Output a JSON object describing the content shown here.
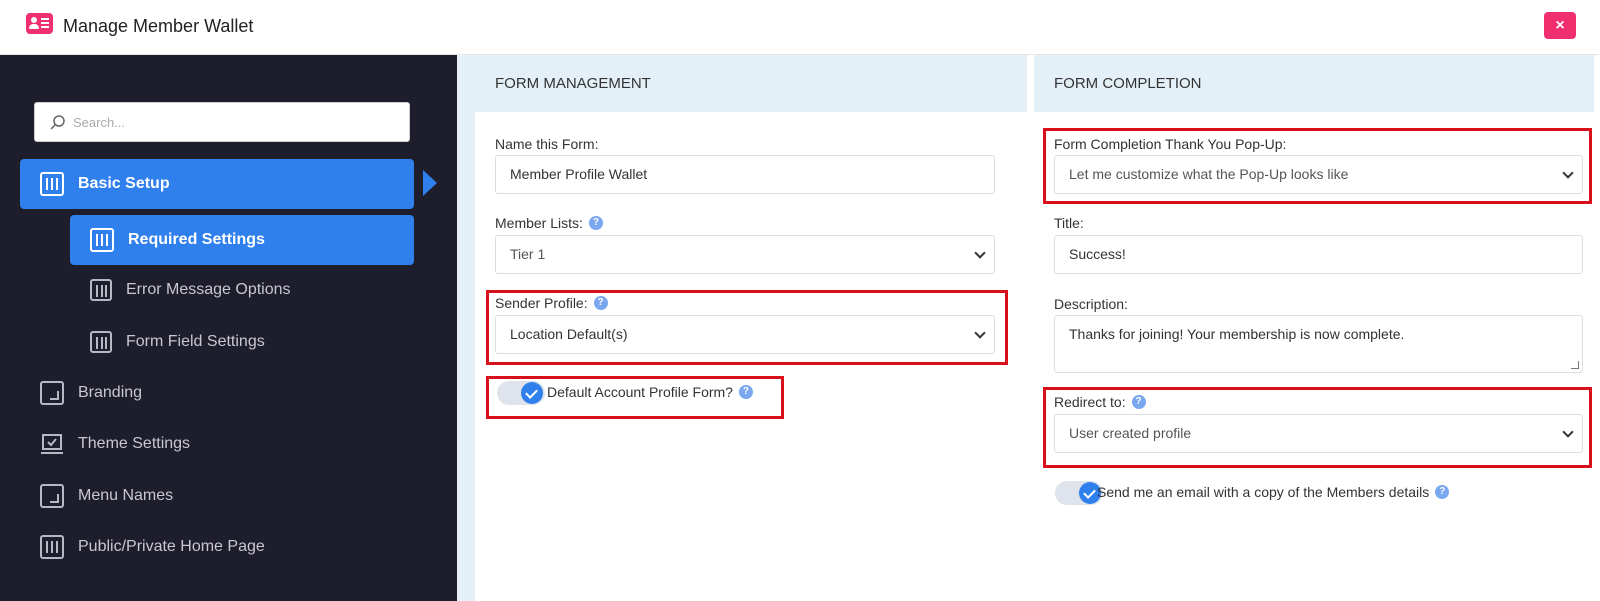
{
  "window": {
    "title": "Manage Member Wallet",
    "close_label": "×"
  },
  "sidebar": {
    "search_placeholder": "Search...",
    "items": [
      {
        "label": "Basic Setup"
      },
      {
        "label": "Required Settings"
      },
      {
        "label": "Error Message Options"
      },
      {
        "label": "Form Field Settings"
      },
      {
        "label": "Branding"
      },
      {
        "label": "Theme Settings"
      },
      {
        "label": "Menu Names"
      },
      {
        "label": "Public/Private Home Page"
      }
    ]
  },
  "form_management": {
    "heading": "FORM MANAGEMENT",
    "name_label": "Name this Form:",
    "name_value": "Member Profile Wallet",
    "lists_label": "Member Lists:",
    "lists_value": "Tier 1",
    "sender_label": "Sender Profile:",
    "sender_value": "Location Default(s)",
    "default_toggle_label": "Default Account Profile Form?"
  },
  "form_completion": {
    "heading": "FORM COMPLETION",
    "popup_label": "Form Completion Thank You Pop-Up:",
    "popup_value": "Let me customize what the Pop-Up looks like",
    "title_label": "Title:",
    "title_value": "Success!",
    "description_label": "Description:",
    "description_value": "Thanks for joining! Your membership is now complete.",
    "redirect_label": "Redirect to:",
    "redirect_value": "User created profile",
    "email_toggle_label": "Send me an email with a copy of the Members details"
  },
  "help_glyph": "?",
  "colors": {
    "accent": "#2f80ed",
    "brand": "#ef2f6e",
    "sidebar_bg": "#1e1d2b",
    "highlight": "#d8101b"
  }
}
